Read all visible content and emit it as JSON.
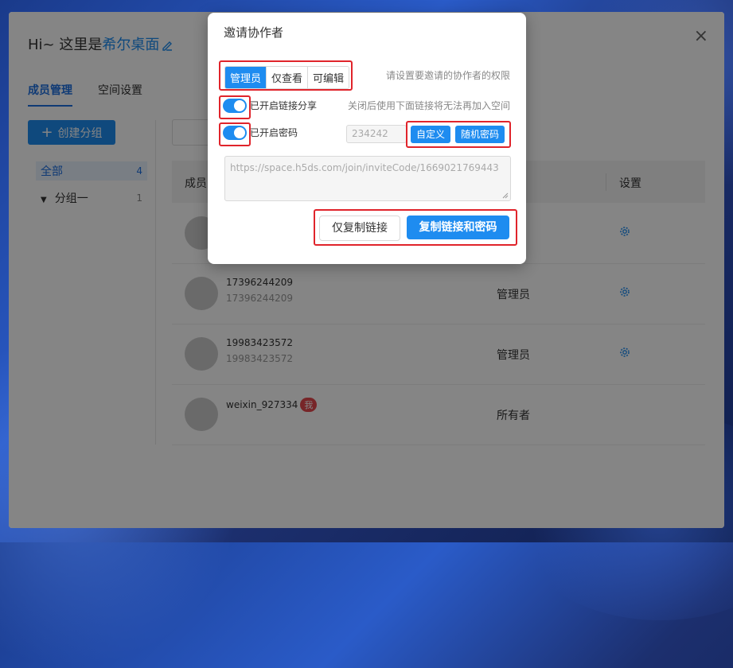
{
  "page": {
    "greeting_prefix": "Hi~ 这里是",
    "brand": "希尔桌面",
    "close_glyph": "×"
  },
  "tabs": [
    {
      "label": "成员管理",
      "active": true
    },
    {
      "label": "空间设置",
      "active": false
    }
  ],
  "sidebar": {
    "create_group_label": "创建分组",
    "groups": [
      {
        "label": "全部",
        "count": "4"
      },
      {
        "label": "分组一",
        "count": "1"
      }
    ]
  },
  "table": {
    "headers": {
      "member": "成员",
      "settings": "设置"
    },
    "rows": [
      {
        "name": "",
        "sub": "",
        "role": "",
        "settings_icon": "gear-icon"
      },
      {
        "name": "17396244209",
        "sub": "17396244209",
        "role": "管理员",
        "settings_icon": "gear-icon"
      },
      {
        "name": "19983423572",
        "sub": "19983423572",
        "role": "管理员",
        "settings_icon": "gear-icon"
      },
      {
        "name": "weixin_927334",
        "badge": "我",
        "role": "所有者"
      }
    ]
  },
  "dialog": {
    "title": "邀请协作者",
    "permissions": [
      "管理员",
      "仅查看",
      "可编辑"
    ],
    "selected_permission": "管理员",
    "permission_hint": "请设置要邀请的协作者的权限",
    "link_share_label": "已开启链接分享",
    "link_share_on": true,
    "link_share_hint": "关闭后使用下面链接将无法再加入空间",
    "password_label": "已开启密码",
    "password_on": true,
    "password_value": "234242",
    "custom_btn": "自定义",
    "random_btn": "随机密码",
    "invite_link": "https://space.h5ds.com/join/inviteCode/1669021769443",
    "copy_link_btn": "仅复制链接",
    "copy_link_password_btn": "复制链接和密码"
  },
  "colors": {
    "accent": "#1e8cf0",
    "highlight_border": "#e0242b",
    "badge": "#e5484d"
  }
}
